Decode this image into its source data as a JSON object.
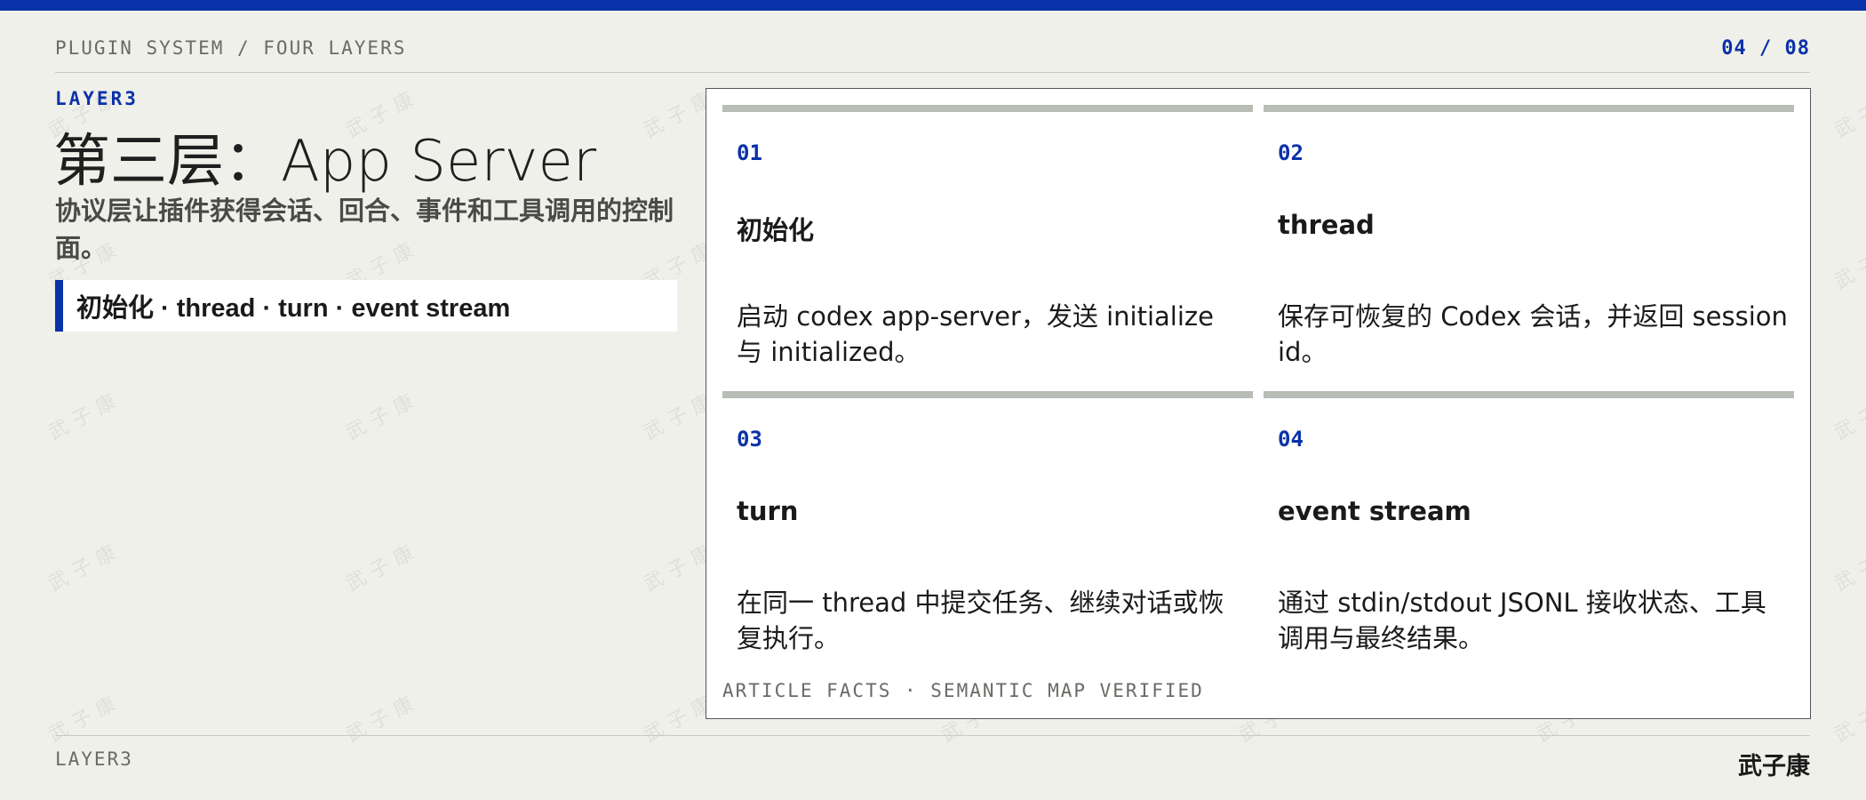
{
  "header": {
    "eyebrow": "PLUGIN SYSTEM / FOUR LAYERS",
    "pager": "04 / 08"
  },
  "left": {
    "layer_tag": "LAYER3",
    "title": "第三层：App Server",
    "subtitle": "协议层让插件获得会话、回合、事件和工具调用的控制面。",
    "tagline": "初始化 · thread · turn · event stream"
  },
  "cards": [
    {
      "num": "01",
      "name": "初始化",
      "desc": "启动 codex app-server，发送 initialize 与 initialized。"
    },
    {
      "num": "02",
      "name": "thread",
      "desc": "保存可恢复的 Codex 会话，并返回 session id。"
    },
    {
      "num": "03",
      "name": "turn",
      "desc": "在同一 thread 中提交任务、继续对话或恢复执行。"
    },
    {
      "num": "04",
      "name": "event stream",
      "desc": "通过 stdin/stdout JSONL 接收状态、工具调用与最终结果。"
    }
  ],
  "panel_footer": "ARTICLE FACTS · SEMANTIC MAP VERIFIED",
  "footer": {
    "left": "LAYER3",
    "right": "武子康"
  },
  "watermark": "武子康",
  "colors": {
    "accent": "#0a32a8",
    "background": "#f0f0eb",
    "card_bar": "#b8bdb5"
  }
}
